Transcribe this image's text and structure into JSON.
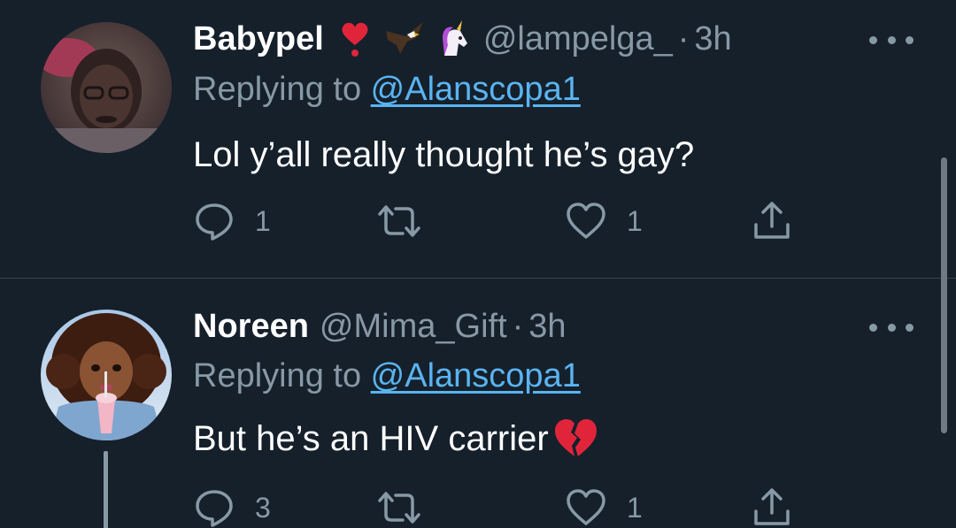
{
  "tweets": [
    {
      "display_name": "Babypel",
      "name_emojis": [
        "heart-exclamation-icon",
        "eagle-icon",
        "unicorn-icon"
      ],
      "handle": "@lampelga_",
      "separator": "·",
      "time": "3h",
      "replying_prefix": "Replying to",
      "replying_to": "@Alanscopa1",
      "text": "Lol y’all really thought he’s gay?",
      "text_emoji": "",
      "reply_count": "1",
      "retweet_count": "",
      "like_count": "1"
    },
    {
      "display_name": "Noreen",
      "name_emojis": [],
      "handle": "@Mima_Gift",
      "separator": "·",
      "time": "3h",
      "replying_prefix": "Replying to",
      "replying_to": "@Alanscopa1",
      "text": "But he’s an HIV carrier",
      "text_emoji": "broken-heart-icon",
      "reply_count": "3",
      "retweet_count": "",
      "like_count": "1"
    }
  ],
  "colors": {
    "background": "#15202b",
    "secondary_text": "#8899a6",
    "link": "#5ab4f0",
    "divider": "#38444d"
  }
}
